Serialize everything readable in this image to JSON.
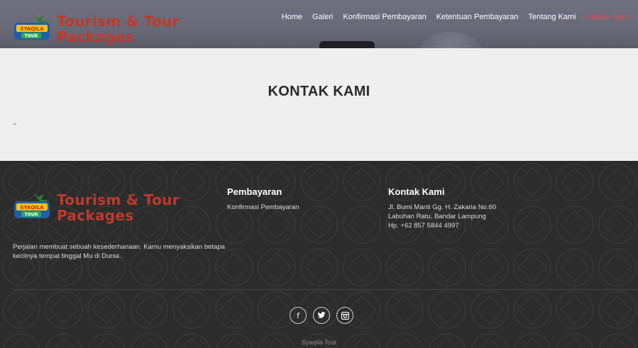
{
  "brand": {
    "badge_line1": "SYAQILA",
    "badge_line2": "TOUR",
    "title_line1": "Tourism & Tour",
    "title_line2": "Packages",
    "title_color": "#c0392b"
  },
  "nav": {
    "items": [
      {
        "label": "Home"
      },
      {
        "label": "Galeri"
      },
      {
        "label": "Konfirmasi Pembayaran"
      },
      {
        "label": "Ketentuan Pembayaran"
      },
      {
        "label": "Tentang Kami"
      },
      {
        "label": "Kontak Kami"
      }
    ],
    "active_color": "#e44b54"
  },
  "page": {
    "title": "KONTAK KAMI",
    "dash": "–"
  },
  "footer": {
    "description": "Perjalan membuat sebuah kesederhanaan. Kamu menyaksikan betapa kecilnya tempat tinggal Mu di Dunia.",
    "payment": {
      "heading": "Pembayaran",
      "link": "Konfirmasi Pembayaran"
    },
    "contact": {
      "heading": "Kontak Kami",
      "address1": "Jl. Bumi Manti Gg. H. Zakaria No.60",
      "address2": "Labuhan Ratu, Bandar Lampung",
      "phone": "Hp. +62 857 5844 4997"
    },
    "social": [
      {
        "icon": "facebook-icon",
        "glyph": "f"
      },
      {
        "icon": "twitter-icon",
        "glyph": "🐦"
      },
      {
        "icon": "instagram-icon",
        "glyph": "◙"
      }
    ],
    "copyright": "Syaqila Tour"
  }
}
